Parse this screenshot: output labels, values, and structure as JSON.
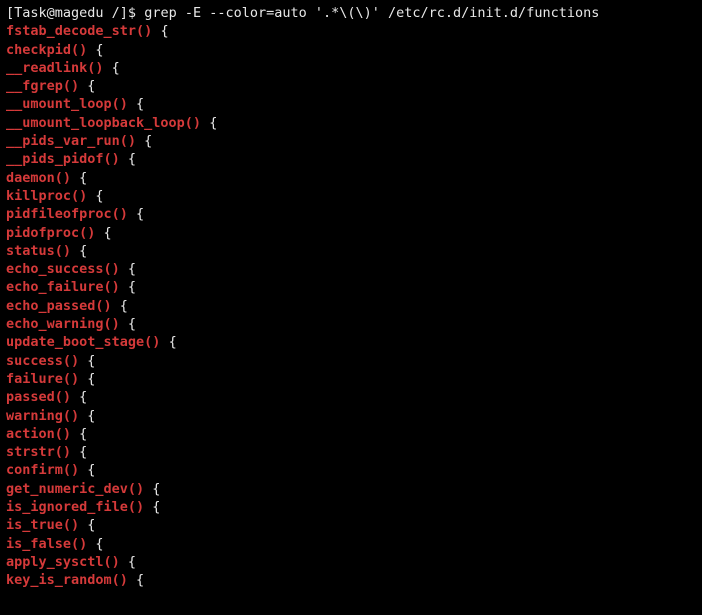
{
  "prompt": {
    "user_host_path": "[Task@magedu /]$",
    "command": "grep -E --color=auto '.*\\(\\)' /etc/rc.d/init.d/functions"
  },
  "lines": [
    {
      "match": "fstab_decode_str()",
      "rest": " {"
    },
    {
      "match": "checkpid()",
      "rest": " {"
    },
    {
      "match": "__readlink()",
      "rest": " {"
    },
    {
      "match": "__fgrep()",
      "rest": " {"
    },
    {
      "match": "__umount_loop()",
      "rest": " {"
    },
    {
      "match": "__umount_loopback_loop()",
      "rest": " {"
    },
    {
      "match": "__pids_var_run()",
      "rest": " {"
    },
    {
      "match": "__pids_pidof()",
      "rest": " {"
    },
    {
      "match": "daemon()",
      "rest": " {"
    },
    {
      "match": "killproc()",
      "rest": " {"
    },
    {
      "match": "pidfileofproc()",
      "rest": " {"
    },
    {
      "match": "pidofproc()",
      "rest": " {"
    },
    {
      "match": "status()",
      "rest": " {"
    },
    {
      "match": "echo_success()",
      "rest": " {"
    },
    {
      "match": "echo_failure()",
      "rest": " {"
    },
    {
      "match": "echo_passed()",
      "rest": " {"
    },
    {
      "match": "echo_warning()",
      "rest": " {"
    },
    {
      "match": "update_boot_stage()",
      "rest": " {"
    },
    {
      "match": "success()",
      "rest": " {"
    },
    {
      "match": "failure()",
      "rest": " {"
    },
    {
      "match": "passed()",
      "rest": " {"
    },
    {
      "match": "warning()",
      "rest": " {"
    },
    {
      "match": "action()",
      "rest": " {"
    },
    {
      "match": "strstr()",
      "rest": " {"
    },
    {
      "match": "confirm()",
      "rest": " {"
    },
    {
      "match": "get_numeric_dev()",
      "rest": " {"
    },
    {
      "match": "is_ignored_file()",
      "rest": " {"
    },
    {
      "match": "is_true()",
      "rest": " {"
    },
    {
      "match": "is_false()",
      "rest": " {"
    },
    {
      "match": "apply_sysctl()",
      "rest": " {"
    },
    {
      "match": "key_is_random()",
      "rest": " {"
    }
  ]
}
